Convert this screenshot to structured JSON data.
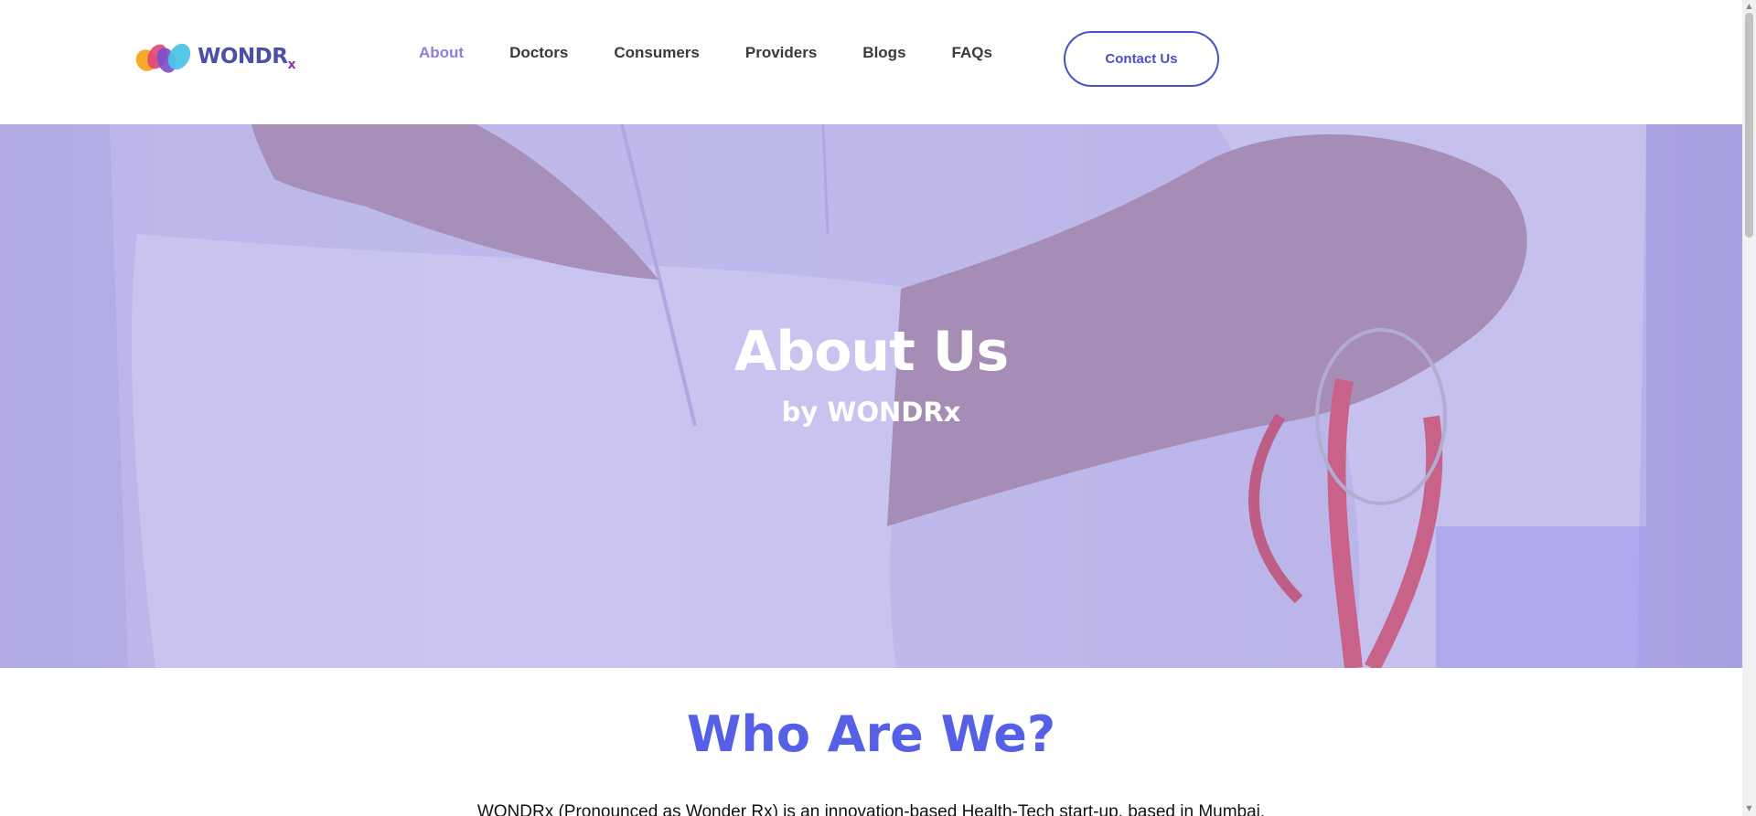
{
  "header": {
    "logo_text": "WONDR",
    "logo_sub": "x",
    "nav": [
      {
        "label": "About",
        "active": true
      },
      {
        "label": "Doctors",
        "active": false
      },
      {
        "label": "Consumers",
        "active": false
      },
      {
        "label": "Providers",
        "active": false
      },
      {
        "label": "Blogs",
        "active": false
      },
      {
        "label": "FAQs",
        "active": false
      }
    ],
    "contact_label": "Contact Us"
  },
  "hero": {
    "title": "About Us",
    "subtitle": "by WONDRx"
  },
  "content": {
    "section_title": "Who Are We?",
    "intro": "WONDRx (Pronounced as Wonder Rx) is an innovation-based Health-Tech start-up, based in Mumbai."
  },
  "colors": {
    "accent": "#5660e6",
    "nav_active": "#8b7fe0",
    "button_border": "#4b4fc9"
  }
}
